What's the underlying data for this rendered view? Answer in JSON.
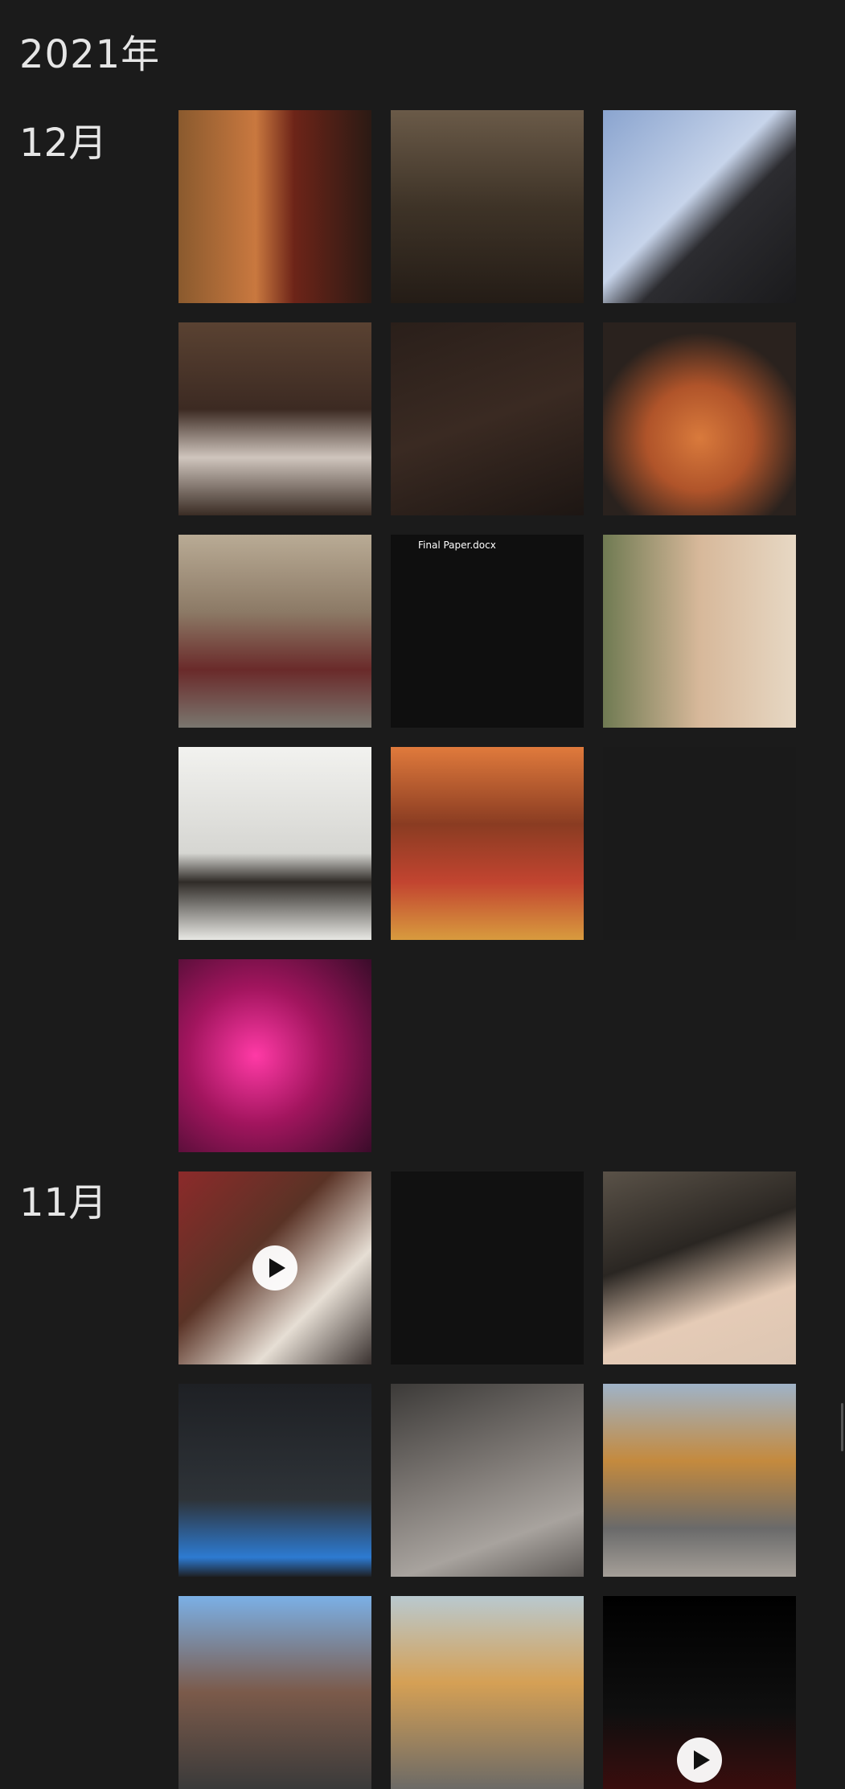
{
  "header": {
    "year": "2021年"
  },
  "months": [
    {
      "label": "12月",
      "photos": [
        {
          "kind": "photo",
          "icon": "food-table-photo"
        },
        {
          "kind": "photo",
          "icon": "staircase-portrait-photo"
        },
        {
          "kind": "photo",
          "icon": "skyscraper-photo"
        },
        {
          "kind": "photo",
          "icon": "masked-selfie-photo"
        },
        {
          "kind": "photo",
          "icon": "dark-blurry-photo"
        },
        {
          "kind": "photo",
          "icon": "ramen-photo"
        },
        {
          "kind": "photo",
          "icon": "street-portrait-photo"
        },
        {
          "kind": "screenshot",
          "icon": "chat-screenshot",
          "caption": "Final Paper.docx"
        },
        {
          "kind": "photo",
          "icon": "two-girls-selfie-photo"
        },
        {
          "kind": "photo",
          "icon": "whiteboard-classroom-photo"
        },
        {
          "kind": "photo",
          "icon": "restaurant-food-photo"
        },
        {
          "kind": "screenshot",
          "icon": "message-list-screenshot"
        },
        {
          "kind": "photo",
          "icon": "pink-light-selfie-photo"
        }
      ]
    },
    {
      "label": "11月",
      "photos": [
        {
          "kind": "video",
          "icon": "birthday-cake-video"
        },
        {
          "kind": "screenshot",
          "icon": "chat-screenshot"
        },
        {
          "kind": "photo",
          "icon": "bandaged-finger-photo"
        },
        {
          "kind": "screenshot",
          "icon": "code-editor-screenshot"
        },
        {
          "kind": "photo",
          "icon": "gray-cat-photo"
        },
        {
          "kind": "photo",
          "icon": "autumn-road-photo"
        },
        {
          "kind": "photo",
          "icon": "victorian-building-photo"
        },
        {
          "kind": "photo",
          "icon": "autumn-path-photo"
        },
        {
          "kind": "video",
          "icon": "dark-car-video"
        }
      ]
    }
  ]
}
